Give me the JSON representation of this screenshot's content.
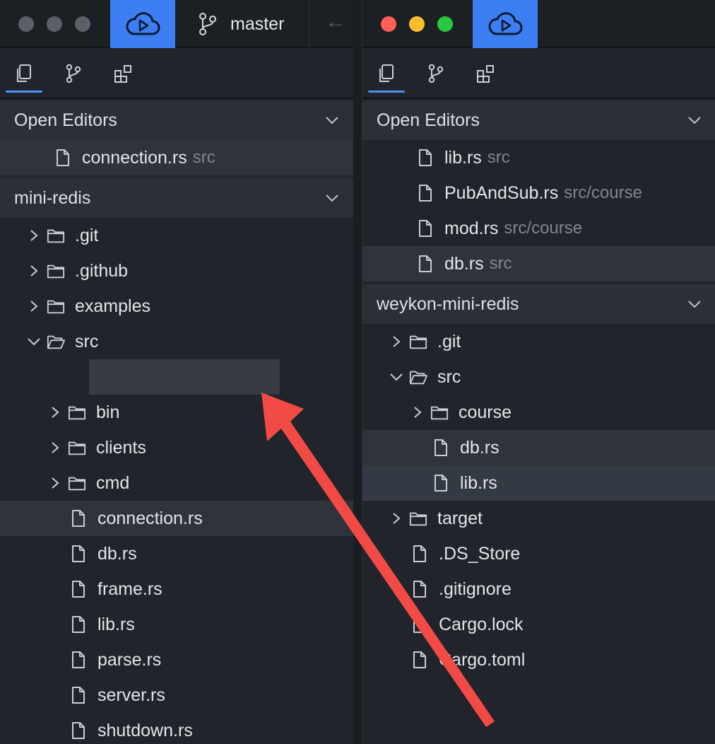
{
  "left": {
    "titlebar": {
      "branch": "master"
    },
    "open_editors": {
      "title": "Open Editors",
      "items": [
        {
          "name": "connection.rs",
          "desc": "src"
        }
      ]
    },
    "project": {
      "title": "mini-redis",
      "tree": [
        {
          "name": ".git",
          "type": "folder",
          "expanded": false
        },
        {
          "name": ".github",
          "type": "folder",
          "expanded": false
        },
        {
          "name": "examples",
          "type": "folder",
          "expanded": false
        },
        {
          "name": "src",
          "type": "folder",
          "expanded": true
        },
        {
          "name": "bin",
          "type": "folder",
          "expanded": false
        },
        {
          "name": "clients",
          "type": "folder",
          "expanded": false
        },
        {
          "name": "cmd",
          "type": "folder",
          "expanded": false
        },
        {
          "name": "connection.rs",
          "type": "file"
        },
        {
          "name": "db.rs",
          "type": "file"
        },
        {
          "name": "frame.rs",
          "type": "file"
        },
        {
          "name": "lib.rs",
          "type": "file"
        },
        {
          "name": "parse.rs",
          "type": "file"
        },
        {
          "name": "server.rs",
          "type": "file"
        },
        {
          "name": "shutdown.rs",
          "type": "file"
        }
      ]
    }
  },
  "right": {
    "open_editors": {
      "title": "Open Editors",
      "items": [
        {
          "name": "lib.rs",
          "desc": "src"
        },
        {
          "name": "PubAndSub.rs",
          "desc": "src/course"
        },
        {
          "name": "mod.rs",
          "desc": "src/course"
        },
        {
          "name": "db.rs",
          "desc": "src"
        }
      ]
    },
    "project": {
      "title": "weykon-mini-redis",
      "tree": [
        {
          "name": ".git",
          "type": "folder",
          "expanded": false
        },
        {
          "name": "src",
          "type": "folder",
          "expanded": true
        },
        {
          "name": "course",
          "type": "folder",
          "expanded": false
        },
        {
          "name": "db.rs",
          "type": "file"
        },
        {
          "name": "lib.rs",
          "type": "file"
        },
        {
          "name": "target",
          "type": "folder",
          "expanded": false
        },
        {
          "name": ".DS_Store",
          "type": "file"
        },
        {
          "name": ".gitignore",
          "type": "file"
        },
        {
          "name": "Cargo.lock",
          "type": "file"
        },
        {
          "name": "Cargo.toml",
          "type": "file"
        }
      ]
    }
  },
  "colors": {
    "accent": "#3d7ff2",
    "annotation_arrow": "#f24b45",
    "traffic_red": "#fe5f57",
    "traffic_yellow": "#febc2e",
    "traffic_green": "#28c840"
  }
}
